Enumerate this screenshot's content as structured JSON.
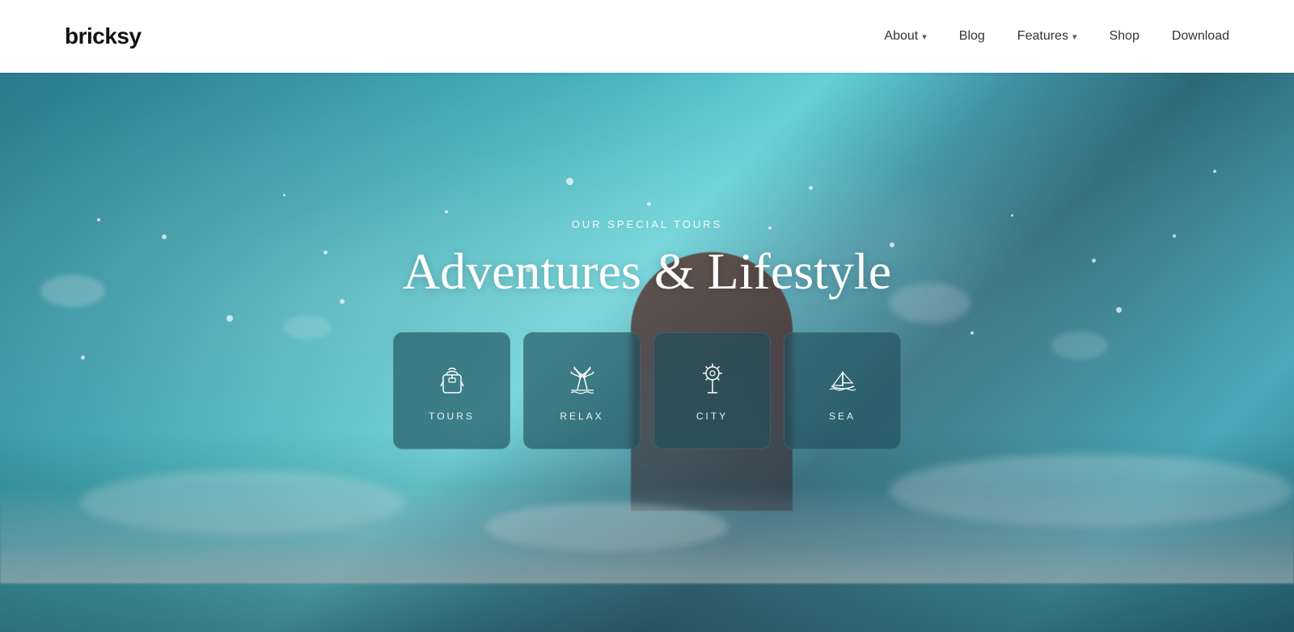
{
  "header": {
    "logo": "bricksy",
    "nav": {
      "about_label": "About",
      "about_chevron": "▾",
      "blog_label": "Blog",
      "features_label": "Features",
      "features_chevron": "▾",
      "shop_label": "Shop",
      "download_label": "Download"
    }
  },
  "hero": {
    "subtitle": "OUR SPECIAL TOURS",
    "title": "Adventures & Lifestyle",
    "cards": [
      {
        "id": "tours",
        "label": "TOURS",
        "icon": "backpack-icon"
      },
      {
        "id": "relax",
        "label": "RELAX",
        "icon": "palm-icon"
      },
      {
        "id": "city",
        "label": "CITY",
        "icon": "lighthouse-icon"
      },
      {
        "id": "sea",
        "label": "SEA",
        "icon": "sailboat-icon"
      }
    ]
  }
}
